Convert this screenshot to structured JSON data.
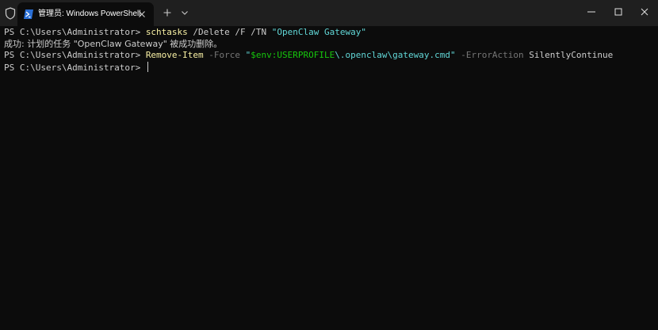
{
  "colors": {
    "titlebar_bg": "#1f1f1f",
    "terminal_bg": "#0c0c0c",
    "text_default": "#cccccc",
    "command_yellow": "#f9f1a5",
    "parameter_gray": "#767676",
    "string_cyan": "#61d6d6",
    "variable_green": "#16c60c"
  },
  "titlebar": {
    "shield_icon": "shield-icon",
    "tab": {
      "icon": "powershell-icon",
      "title": "管理员: Windows PowerShell",
      "close_icon": "close-icon"
    },
    "new_tab_icon": "plus-icon",
    "dropdown_icon": "chevron-down-icon",
    "window_controls": {
      "minimize_icon": "minimize-icon",
      "maximize_icon": "maximize-icon",
      "close_icon": "close-icon"
    }
  },
  "terminal": {
    "lines": [
      {
        "prompt": "PS C:\\Users\\Administrator> ",
        "command": "schtasks",
        "args": " /Delete /F /TN ",
        "string": "\"OpenClaw Gateway\""
      },
      {
        "output": "成功: 计划的任务 \"OpenClaw Gateway\" 被成功删除。"
      },
      {
        "prompt": "PS C:\\Users\\Administrator> ",
        "command": "Remove-Item",
        "param1": " -Force ",
        "string_open": "\"",
        "variable": "$env:USERPROFILE",
        "string_rest": "\\.openclaw\\gateway.cmd\"",
        "param2": " -ErrorAction ",
        "param2_value": "SilentlyContinue"
      },
      {
        "prompt": "PS C:\\Users\\Administrator> "
      }
    ]
  }
}
